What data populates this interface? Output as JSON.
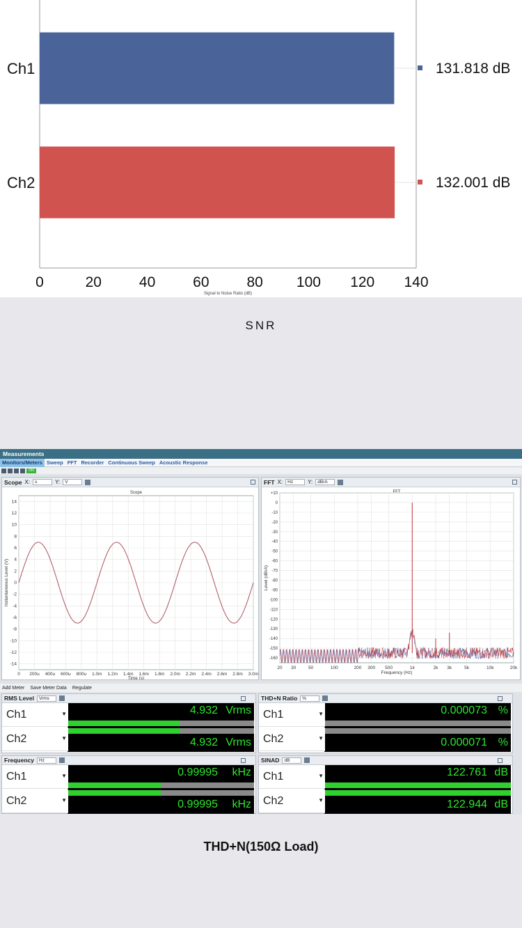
{
  "chart_data": [
    {
      "type": "bar",
      "orientation": "horizontal",
      "categories": [
        "Ch1",
        "Ch2"
      ],
      "values": [
        131.818,
        132.001
      ],
      "value_labels": [
        "131.818  dB",
        "132.001  dB"
      ],
      "colors": [
        "#4a6499",
        "#d05350"
      ],
      "xlabel": "Signal to Noise Ratio (dB)",
      "xticks": [
        "0",
        "20",
        "40",
        "60",
        "80",
        "100",
        "120",
        "140"
      ],
      "xlim": [
        0,
        140
      ],
      "caption": "SNR"
    },
    {
      "type": "line",
      "title": "Scope",
      "xlabel": "Time (s)",
      "ylabel": "Instantaneous Level (V)",
      "xlim": [
        0,
        0.003
      ],
      "ylim": [
        -15,
        15
      ],
      "xticks": [
        "0",
        "200u",
        "400u",
        "600u",
        "800u",
        "1.0m",
        "1.2m",
        "1.4m",
        "1.6m",
        "1.8m",
        "2.0m",
        "2.2m",
        "2.4m",
        "2.6m",
        "2.8m",
        "3.0m"
      ],
      "yticks": [
        "14",
        "12",
        "10",
        "8",
        "6",
        "4",
        "2",
        "0",
        "-2",
        "-4",
        "-6",
        "-8",
        "-10",
        "-12",
        "-14"
      ],
      "series": [
        {
          "amplitude": 6.97,
          "frequency_hz": 1000,
          "color": "#b0606a"
        }
      ]
    },
    {
      "type": "line",
      "title": "FFT",
      "xlabel": "Frequency (Hz)",
      "ylabel": "Level (dBrA)",
      "x_scale": "log",
      "xlim": [
        20,
        20000
      ],
      "ylim": [
        -165,
        10
      ],
      "xticks": [
        "20",
        "30",
        "50",
        "100",
        "200",
        "300",
        "500",
        "1k",
        "2k",
        "3k",
        "5k",
        "10k",
        "20k"
      ],
      "yticks": [
        "+10",
        "0",
        "-10",
        "-20",
        "-30",
        "-40",
        "-50",
        "-60",
        "-70",
        "-80",
        "-90",
        "-100",
        "-110",
        "-120",
        "-130",
        "-140",
        "-150",
        "-160"
      ],
      "peaks": [
        {
          "x": 1000,
          "y": 0
        },
        {
          "x": 2000,
          "y": -140
        },
        {
          "x": 3000,
          "y": -134
        }
      ],
      "noise_floor": -155,
      "colors": [
        "#4060b0",
        "#c03030"
      ]
    }
  ],
  "window": {
    "title": "Measurements",
    "tabs": [
      "Monitors/Meters",
      "Sweep",
      "FFT",
      "Recorder",
      "Continuous Sweep",
      "Acoustic Response"
    ],
    "on_label": "ON"
  },
  "scope": {
    "label": "Scope",
    "x_label": "X:",
    "x_unit": "s",
    "y_label": "Y:",
    "y_unit": "V"
  },
  "fft": {
    "label": "FFT",
    "x_label": "X:",
    "x_unit": "Hz",
    "y_label": "Y:",
    "y_unit": "dBrA"
  },
  "meter_bar": {
    "add": "Add Meter",
    "save": "Save Meter Data",
    "regulate": "Regulate"
  },
  "meters": [
    {
      "title": "RMS Level",
      "unit_select": "Vrms",
      "rows": [
        {
          "ch": "Ch1",
          "value": "4.932",
          "unit": "Vrms",
          "level": 0.6
        },
        {
          "ch": "Ch2",
          "value": "4.932",
          "unit": "Vrms",
          "level": 0.6
        }
      ]
    },
    {
      "title": "THD+N Ratio",
      "unit_select": "%",
      "rows": [
        {
          "ch": "Ch1",
          "value": "0.000073",
          "unit": "%",
          "level": 0
        },
        {
          "ch": "Ch2",
          "value": "0.000071",
          "unit": "%",
          "level": 0
        }
      ]
    },
    {
      "title": "Frequency",
      "unit_select": "Hz",
      "rows": [
        {
          "ch": "Ch1",
          "value": "0.99995",
          "unit": "kHz",
          "level": 0.5
        },
        {
          "ch": "Ch2",
          "value": "0.99995",
          "unit": "kHz",
          "level": 0.5
        }
      ]
    },
    {
      "title": "SINAD",
      "unit_select": "dB",
      "rows": [
        {
          "ch": "Ch1",
          "value": "122.761",
          "unit": "dB",
          "level": 1
        },
        {
          "ch": "Ch2",
          "value": "122.944",
          "unit": "dB",
          "level": 1
        }
      ]
    }
  ],
  "captions": {
    "snr": "SNR",
    "thd": "THD+N(150Ω Load)"
  }
}
